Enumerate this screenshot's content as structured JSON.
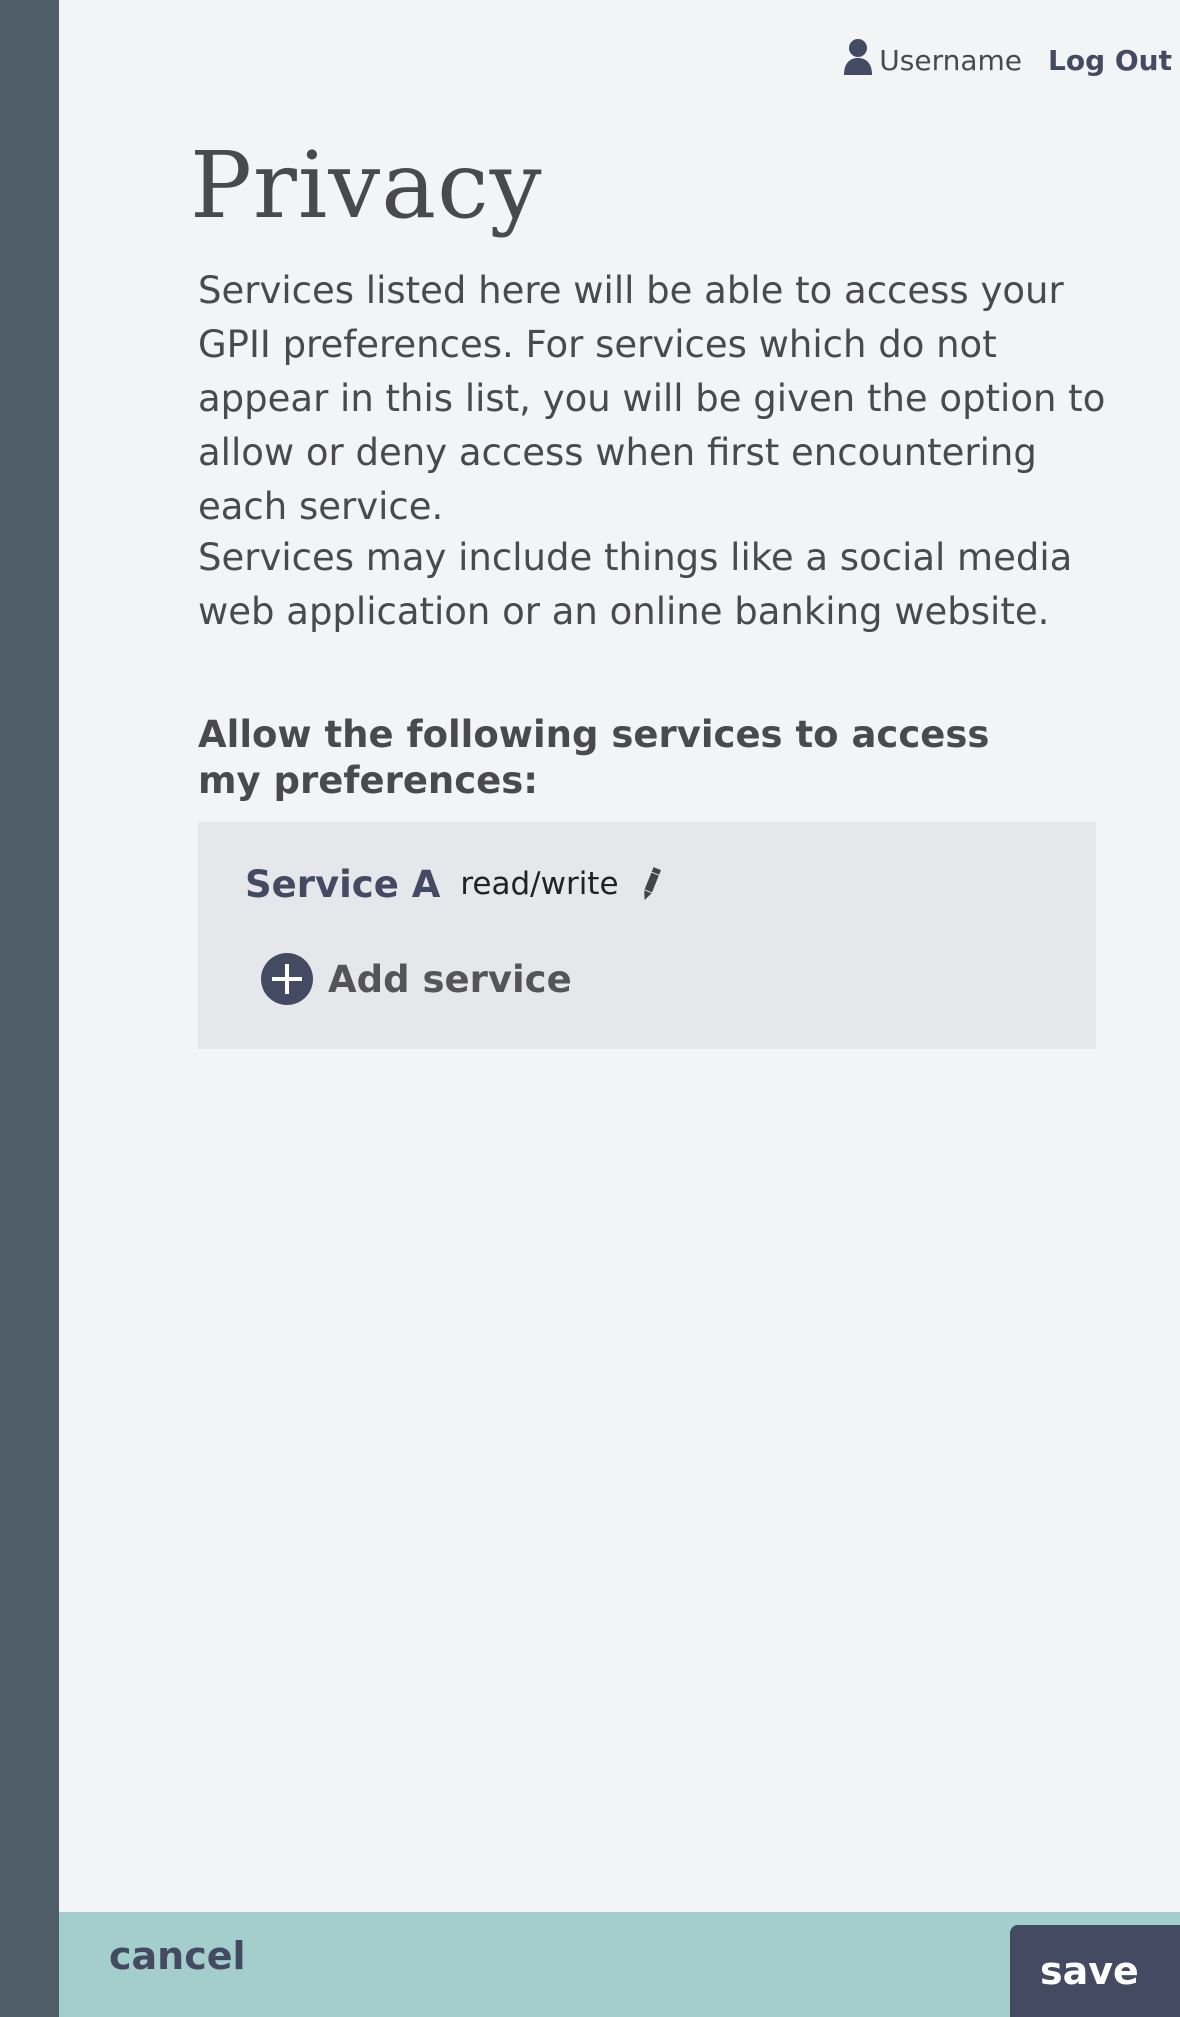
{
  "header": {
    "username": "Username",
    "logout_label": "Log Out"
  },
  "page": {
    "title": "Privacy",
    "intro": "Services listed here will be able to access your GPII preferences. For services which do not appear in this list, you will be given the option to allow or deny access when first encountering each service.",
    "intro2": "Services may include things like a social media web application or an online banking website.",
    "allow_heading": "Allow the following services to access my preferences:"
  },
  "services": {
    "items": [
      {
        "name": "Service A",
        "access": "read/write"
      }
    ],
    "add_label": "Add service"
  },
  "footer": {
    "cancel_label": "cancel",
    "save_label": "save"
  },
  "colors": {
    "rail": "#4f5d68",
    "accent": "#434a62",
    "footer_bg": "#a3cecb",
    "panel_bg": "#e6e7ea",
    "page_bg": "#f3f4f6"
  },
  "icons": {
    "user": "user-icon",
    "edit": "pencil-icon",
    "add": "plus-circle-icon"
  }
}
